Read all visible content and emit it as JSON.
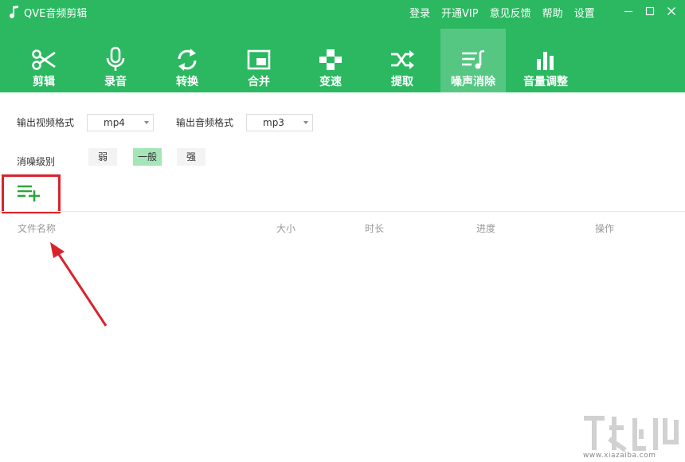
{
  "app": {
    "title": "QVE音频剪辑"
  },
  "top_links": [
    "登录",
    "开通VIP",
    "意见反馈",
    "帮助",
    "设置"
  ],
  "window_controls": [
    "minimize-icon",
    "maximize-icon",
    "close-icon"
  ],
  "toolbar": {
    "items": [
      {
        "label": "剪辑",
        "icon": "scissors-icon"
      },
      {
        "label": "录音",
        "icon": "microphone-icon"
      },
      {
        "label": "转换",
        "icon": "convert-icon"
      },
      {
        "label": "合并",
        "icon": "merge-icon"
      },
      {
        "label": "变速",
        "icon": "speed-icon"
      },
      {
        "label": "提取",
        "icon": "shuffle-icon"
      },
      {
        "label": "噪声消除",
        "icon": "denoise-icon"
      },
      {
        "label": "音量调整",
        "icon": "volume-bars-icon"
      }
    ],
    "active_index": 6
  },
  "settings": {
    "video_format_label": "输出视频格式",
    "video_format_value": "mp4",
    "audio_format_label": "输出音频格式",
    "audio_format_value": "mp3",
    "denoise_level_label": "消噪级别",
    "levels": [
      "弱",
      "一般",
      "强"
    ],
    "selected_level": "一般"
  },
  "file_table": {
    "columns": [
      "文件名称",
      "大小",
      "时长",
      "进度",
      "操作"
    ],
    "rows": []
  },
  "watermark": {
    "text": "www.xiazaiba.com"
  },
  "colors": {
    "brand_green": "#2bb861",
    "active_tab": "#55c782",
    "level_selected": "#a5e5b8",
    "annotation_red": "#d9232c"
  }
}
